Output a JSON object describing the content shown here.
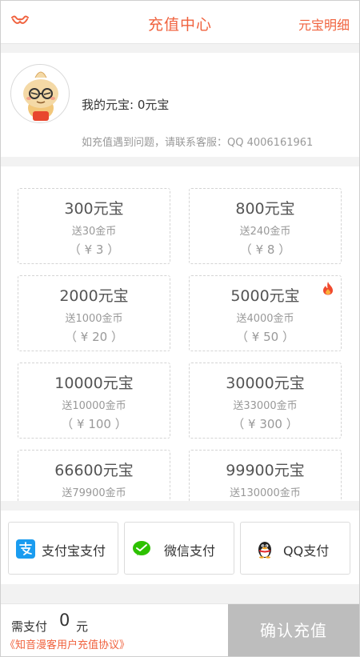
{
  "header": {
    "back_icon": "mustache-back-icon",
    "title": "充值中心",
    "link": "元宝明细"
  },
  "profile": {
    "avatar_icon": "cartoon-avatar",
    "balance_text": "我的元宝: 0元宝",
    "support_text": "如充值遇到问题，请联系客服：QQ 4006161961"
  },
  "packages": [
    {
      "title": "300元宝",
      "bonus": "送30金币",
      "price": "（ ¥ 3 ）",
      "hot": false
    },
    {
      "title": "800元宝",
      "bonus": "送240金币",
      "price": "（ ¥ 8 ）",
      "hot": false
    },
    {
      "title": "2000元宝",
      "bonus": "送1000金币",
      "price": "（ ¥ 20 ）",
      "hot": false
    },
    {
      "title": "5000元宝",
      "bonus": "送4000金币",
      "price": "（ ¥ 50 ）",
      "hot": true
    },
    {
      "title": "10000元宝",
      "bonus": "送10000金币",
      "price": "（ ¥ 100 ）",
      "hot": false
    },
    {
      "title": "30000元宝",
      "bonus": "送33000金币",
      "price": "（ ¥ 300 ）",
      "hot": false
    },
    {
      "title": "66600元宝",
      "bonus": "送79900金币",
      "price": "",
      "hot": false
    },
    {
      "title": "99900元宝",
      "bonus": "送130000金币",
      "price": "",
      "hot": false
    }
  ],
  "payments": [
    {
      "label": "支付宝支付",
      "icon": "alipay-icon"
    },
    {
      "label": "微信支付",
      "icon": "wechat-icon"
    },
    {
      "label": "QQ支付",
      "icon": "qq-penguin-icon"
    }
  ],
  "footer": {
    "need_label": "需支付",
    "amount": "0",
    "unit": "元",
    "agreement": "《知音漫客用户充值协议》",
    "confirm": "确认充值"
  },
  "colors": {
    "accent": "#f0623e",
    "confirm_bg": "#bdbdbd",
    "alipay": "#1a9cf0",
    "wechat": "#2dc100"
  }
}
